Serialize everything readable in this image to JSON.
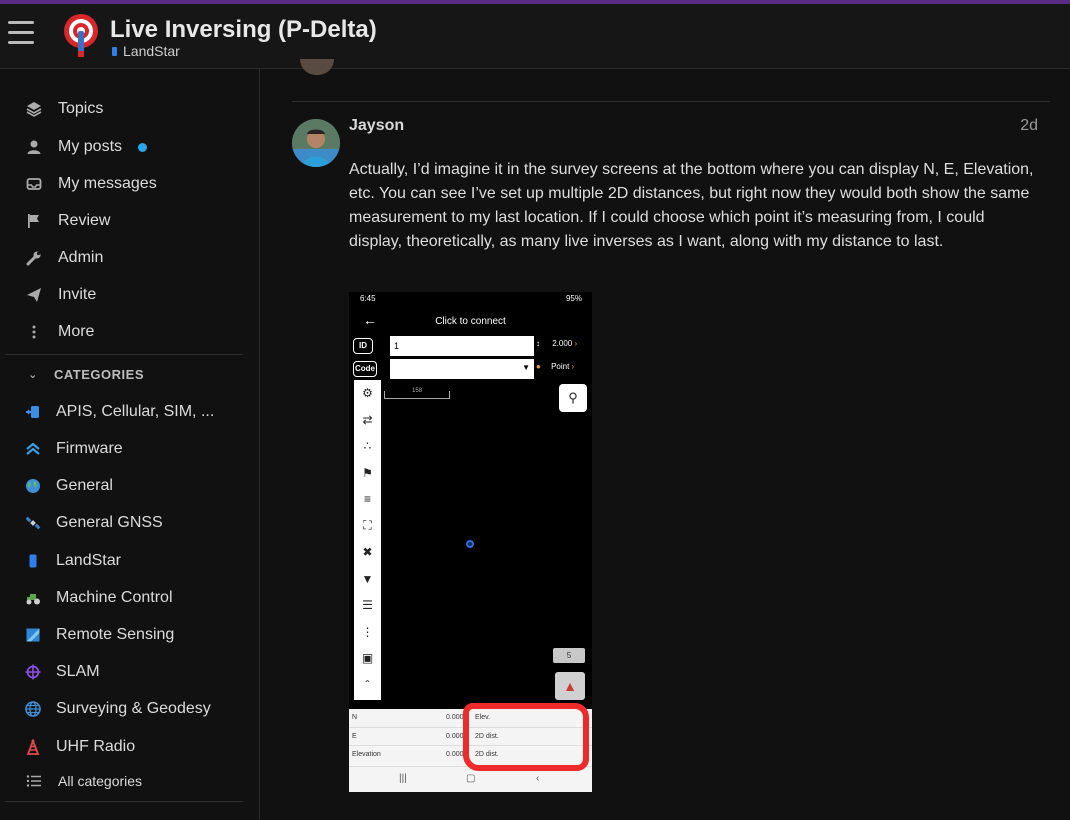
{
  "header": {
    "title": "Live Inversing (P-Delta)",
    "category": "LandStar"
  },
  "sidebar": {
    "nav": [
      {
        "label": "Topics",
        "icon": "layers-icon"
      },
      {
        "label": "My posts",
        "icon": "user-icon"
      },
      {
        "label": "My messages",
        "icon": "inbox-icon"
      },
      {
        "label": "Review",
        "icon": "flag-icon"
      },
      {
        "label": "Admin",
        "icon": "wrench-icon"
      },
      {
        "label": "Invite",
        "icon": "paper-plane-icon"
      },
      {
        "label": "More",
        "icon": "more-vertical-icon"
      }
    ],
    "categories_heading": "CATEGORIES",
    "categories": [
      {
        "label": "APIS, Cellular, SIM, ...",
        "icon": "sim-icon"
      },
      {
        "label": "Firmware",
        "icon": "chevrons-up-icon"
      },
      {
        "label": "General",
        "icon": "globe-icon"
      },
      {
        "label": "General GNSS",
        "icon": "satellite-icon"
      },
      {
        "label": "LandStar",
        "icon": "phone-icon"
      },
      {
        "label": "Machine Control",
        "icon": "tractor-icon"
      },
      {
        "label": "Remote Sensing",
        "icon": "image-icon"
      },
      {
        "label": "SLAM",
        "icon": "crosshair-icon"
      },
      {
        "label": "Surveying & Geodesy",
        "icon": "globe-icon"
      },
      {
        "label": "UHF Radio",
        "icon": "tower-icon"
      }
    ],
    "all_categories": "All categories"
  },
  "post": {
    "author": "Jayson",
    "date": "2d",
    "body": "Actually, I’d imagine it in the survey screens at the bottom where you can display N, E, Elevation, etc. You can see I’ve set up multiple 2D distances, but right now they would both show the same measurement to my last location. If I could choose which point it’s measuring from, I could display, theoretically, as many live inverses as I want, along with my distance to last."
  },
  "screenshot": {
    "time": "6:45",
    "battery": "95%",
    "title": "Click to connect",
    "id_label": "ID",
    "id_value": "1",
    "height_value": "2.000",
    "code_label": "Code",
    "point_label": "Point",
    "scale_label": "158",
    "count": "5",
    "rows": [
      {
        "key": "N",
        "value": "0.000",
        "key2": "Elev."
      },
      {
        "key": "E",
        "value": "0.000",
        "key2": "2D dist."
      },
      {
        "key": "Elevation",
        "value": "0.000",
        "key2": "2D dist."
      }
    ]
  },
  "colors": {
    "accent_purple": "#5b2a86",
    "unread_dot": "#2aa5e6",
    "highlight_red": "#ee2b2b"
  }
}
